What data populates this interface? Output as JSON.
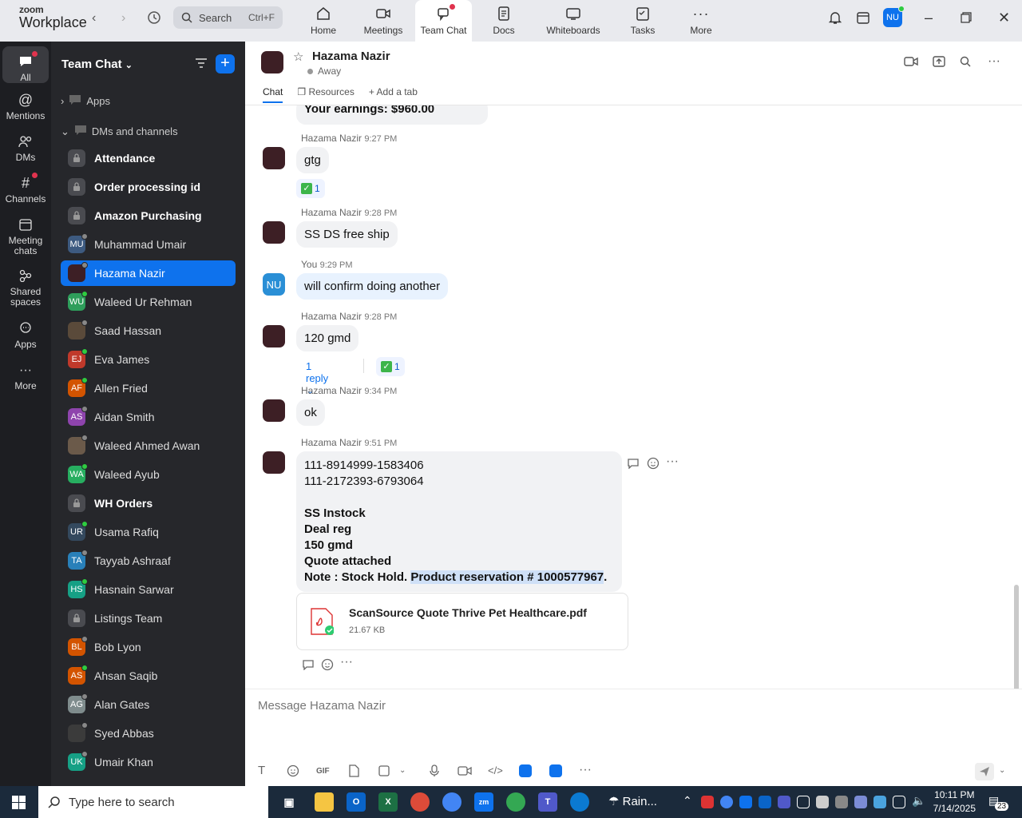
{
  "app": {
    "logo_line1": "zoom",
    "logo_line2": "Workplace"
  },
  "search": {
    "label": "Search",
    "shortcut": "Ctrl+F"
  },
  "navtabs": [
    {
      "label": "Home",
      "icon": "home-icon"
    },
    {
      "label": "Meetings",
      "icon": "video-icon"
    },
    {
      "label": "Team Chat",
      "icon": "chat-icon"
    },
    {
      "label": "Docs",
      "icon": "doc-icon"
    },
    {
      "label": "Whiteboards",
      "icon": "whiteboard-icon"
    },
    {
      "label": "Tasks",
      "icon": "tasks-icon"
    },
    {
      "label": "More",
      "icon": "more-icon"
    }
  ],
  "user_initials": "NU",
  "rail": [
    {
      "label": "All"
    },
    {
      "label": "Mentions"
    },
    {
      "label": "DMs"
    },
    {
      "label": "Channels"
    },
    {
      "label": "Meeting chats"
    },
    {
      "label": "Shared spaces"
    },
    {
      "label": "Apps"
    },
    {
      "label": "More"
    }
  ],
  "sidebar": {
    "title": "Team Chat",
    "apps_label": "Apps",
    "dms_label": "DMs and channels",
    "items": [
      {
        "name": "Attendance",
        "initials": "",
        "color": "#4a4b50",
        "type": "lock",
        "bold": true
      },
      {
        "name": "Order processing id",
        "initials": "",
        "color": "#4a4b50",
        "type": "lock",
        "bold": true
      },
      {
        "name": "Amazon Purchasing",
        "initials": "",
        "color": "#4a4b50",
        "type": "lock",
        "bold": true
      },
      {
        "name": "Muhammad Umair",
        "initials": "MU",
        "color": "#3d5a80",
        "type": "user",
        "status": "#888"
      },
      {
        "name": "Hazama Nazir",
        "initials": "",
        "color": "#3d1f25",
        "type": "user",
        "status": "#888"
      },
      {
        "name": "Waleed Ur Rehman",
        "initials": "WU",
        "color": "#2e9e5b",
        "type": "user",
        "status": "#2ecc40"
      },
      {
        "name": "Saad Hassan",
        "initials": "",
        "color": "#5a4a3a",
        "type": "user",
        "status": "#888"
      },
      {
        "name": "Eva James",
        "initials": "EJ",
        "color": "#c0392b",
        "type": "user",
        "status": "#2ecc40"
      },
      {
        "name": "Allen Fried",
        "initials": "AF",
        "color": "#d35400",
        "type": "user",
        "status": "#2ecc40"
      },
      {
        "name": "Aidan Smith",
        "initials": "AS",
        "color": "#8e44ad",
        "type": "user",
        "status": "#888"
      },
      {
        "name": "Waleed Ahmed Awan",
        "initials": "",
        "color": "#6b5a4a",
        "type": "user",
        "status": "#888"
      },
      {
        "name": "Waleed Ayub",
        "initials": "WA",
        "color": "#27ae60",
        "type": "user",
        "status": "#2ecc40"
      },
      {
        "name": "WH Orders",
        "initials": "",
        "color": "#4a4b50",
        "type": "lock",
        "bold": true
      },
      {
        "name": "Usama Rafiq",
        "initials": "UR",
        "color": "#34495e",
        "type": "user",
        "status": "#2ecc40"
      },
      {
        "name": "Tayyab Ashraaf",
        "initials": "TA",
        "color": "#2980b9",
        "type": "user",
        "status": "#888"
      },
      {
        "name": "Hasnain Sarwar",
        "initials": "HS",
        "color": "#16a085",
        "type": "user",
        "status": "#2ecc40"
      },
      {
        "name": "Listings Team",
        "initials": "",
        "color": "#4a4b50",
        "type": "lock",
        "bold": false
      },
      {
        "name": "Bob Lyon",
        "initials": "BL",
        "color": "#d35400",
        "type": "user",
        "status": "#888"
      },
      {
        "name": "Ahsan Saqib",
        "initials": "AS",
        "color": "#d35400",
        "type": "user",
        "status": "#2ecc40"
      },
      {
        "name": "Alan Gates",
        "initials": "AG",
        "color": "#7f8c8d",
        "type": "user",
        "status": "#888"
      },
      {
        "name": "Syed Abbas",
        "initials": "",
        "color": "#3b3b3b",
        "type": "user",
        "status": "#888"
      },
      {
        "name": "Umair Khan",
        "initials": "UK",
        "color": "#16a085",
        "type": "user",
        "status": "#888"
      }
    ]
  },
  "header": {
    "name": "Hazama Nazir",
    "status": "Away",
    "tabs": [
      "Chat",
      "Resources",
      "Add a tab"
    ]
  },
  "messages": {
    "top_partial": "Your earnings: $960.00",
    "m1": {
      "sender": "Hazama Nazir",
      "time": "9:27 PM",
      "text": "gtg",
      "reaction": "1"
    },
    "m2": {
      "sender": "Hazama Nazir",
      "time": "9:28 PM",
      "text": "SS DS free ship"
    },
    "m3": {
      "sender": "You",
      "time": "9:29 PM",
      "text": "will confirm doing another"
    },
    "m4": {
      "sender": "Hazama Nazir",
      "time": "9:28 PM",
      "text": "120 gmd",
      "reply": "1 reply",
      "reaction": "1"
    },
    "m5": {
      "sender": "Hazama Nazir",
      "time": "9:34 PM",
      "text": "ok"
    },
    "m6": {
      "sender": "Hazama Nazir",
      "time": "9:51 PM",
      "line1": "111-8914999-1583406",
      "line2": "111-2172393-6793064",
      "line3": "SS Instock",
      "line4": "Deal reg",
      "line5": "150 gmd",
      "line6": "Quote attached",
      "note_prefix": "Note : Stock Hold. ",
      "note_highlight": "Product reservation #  1000577967",
      "note_suffix": ".",
      "file_name": "ScanSource Quote Thrive Pet Healthcare.pdf",
      "file_size": "21.67 KB"
    }
  },
  "composer": {
    "placeholder": "Message Hazama Nazir",
    "gif": "GIF"
  },
  "taskbar": {
    "search": "Type here to search",
    "weather": "Rain...",
    "time": "10:11 PM",
    "date": "7/14/2025",
    "notif": "23"
  }
}
